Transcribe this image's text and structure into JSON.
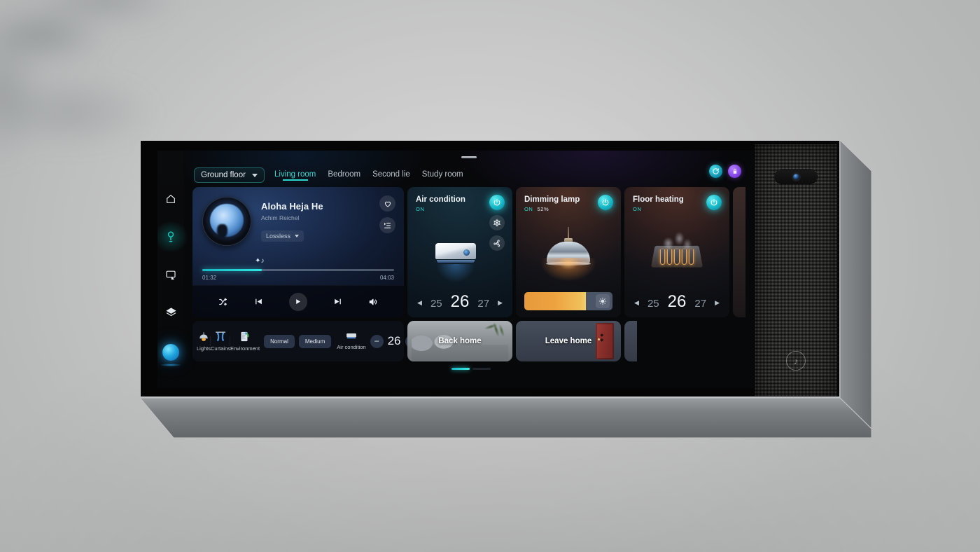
{
  "sidebar": {
    "items": [
      {
        "name": "home",
        "icon": "home-icon",
        "active": false
      },
      {
        "name": "lights",
        "icon": "bulb-icon",
        "active": true
      },
      {
        "name": "screen",
        "icon": "monitor-icon",
        "active": false
      },
      {
        "name": "scenes",
        "icon": "layers-icon",
        "active": false
      },
      {
        "name": "assistant",
        "icon": "voice-orb-icon",
        "active": false
      }
    ]
  },
  "topbar": {
    "floor_select": "Ground floor",
    "rooms": [
      {
        "label": "Living room",
        "active": true
      },
      {
        "label": "Bedroom",
        "active": false
      },
      {
        "label": "Second lie",
        "active": false
      },
      {
        "label": "Study room",
        "active": false
      }
    ],
    "actions": [
      {
        "name": "refresh-icon",
        "color": "#16b8c8"
      },
      {
        "name": "lock-icon",
        "color": "#7b3fe0"
      }
    ]
  },
  "music": {
    "title": "Aloha Heja He",
    "artist": "Achim Reichel",
    "quality": "Lossless",
    "elapsed": "01:32",
    "duration": "04:03",
    "progress_percent": 31,
    "favorite_icon": "heart-icon",
    "playlist_icon": "playlist-icon",
    "controls": [
      {
        "name": "shuffle-icon"
      },
      {
        "name": "previous-icon"
      },
      {
        "name": "play-icon"
      },
      {
        "name": "next-icon"
      },
      {
        "name": "volume-icon"
      }
    ]
  },
  "cards": {
    "air_condition": {
      "title": "Air condition",
      "status": "ON",
      "temp_prev": "25",
      "temp_current": "26",
      "temp_next": "27",
      "buttons": [
        "power-icon",
        "snowflake-icon",
        "fan-icon"
      ]
    },
    "dimming_lamp": {
      "title": "Dimming lamp",
      "status": "ON",
      "brightness": "52%",
      "brightness_percent": 70,
      "buttons": [
        "power-icon"
      ],
      "slider_icon": "brightness-icon"
    },
    "floor_heating": {
      "title": "Floor heating",
      "status": "ON",
      "temp_prev": "25",
      "temp_current": "26",
      "temp_next": "27",
      "buttons": [
        "power-icon"
      ]
    }
  },
  "quickbar": {
    "items": [
      {
        "label": "Lights",
        "icon": "ceiling-lamp-icon"
      },
      {
        "label": "Curtains",
        "icon": "curtains-icon"
      },
      {
        "label": "Environment",
        "icon": "environment-icon"
      }
    ],
    "pills": [
      "Normal",
      "Medium"
    ],
    "ac": {
      "label": "Air condition",
      "icon": "ac-unit-icon",
      "minus": "−",
      "value": "26",
      "plus": "+"
    }
  },
  "scenes": [
    {
      "label": "Back home"
    },
    {
      "label": "Leave home"
    }
  ],
  "pagination": {
    "pages": 2,
    "active": 0
  },
  "speaker": {
    "camera_icon": "camera-icon",
    "logo_icon": "music-note-icon"
  },
  "colors": {
    "accent_teal": "#2fd6d0",
    "accent_purple": "#7b3fe0",
    "warm_amber": "#e89a3c"
  }
}
